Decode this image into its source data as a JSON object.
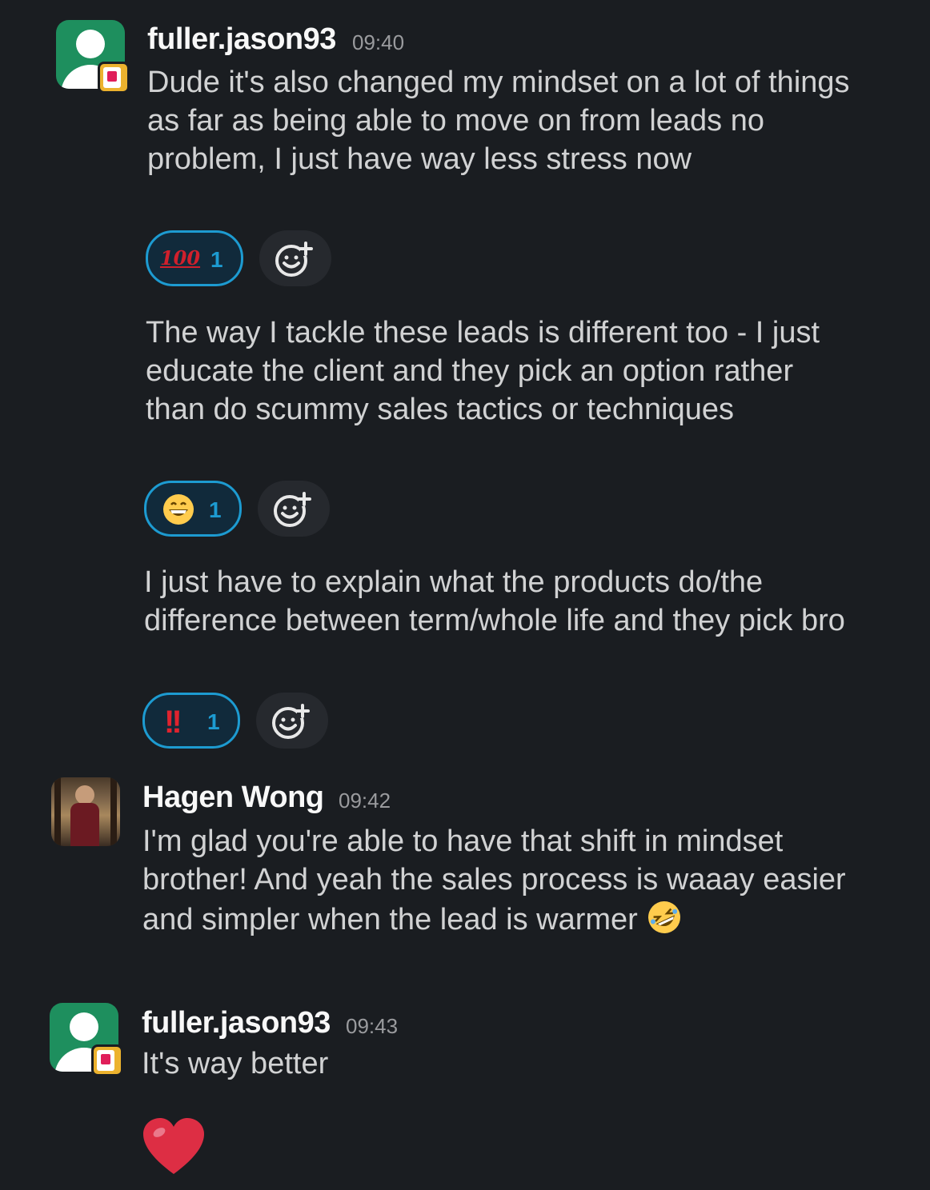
{
  "messages": [
    {
      "username": "fuller.jason93",
      "time": "09:40",
      "paragraphs": [
        {
          "text": "Dude it's also changed my mindset on a lot of things as far as being able to move on from leads no problem, I just have way less stress now",
          "reaction": {
            "emoji": "100",
            "glyph": "100",
            "count": "1"
          }
        },
        {
          "text": "The way I tackle these leads is different too - I just educate the client and they pick an option rather than do scummy sales tactics or techniques",
          "reaction": {
            "emoji": "grin",
            "count": "1"
          }
        },
        {
          "text": "I just have to explain what the products do/the difference between term/whole life and they pick bro",
          "reaction": {
            "emoji": "bangbang",
            "glyph": "!!",
            "count": "1"
          }
        }
      ]
    },
    {
      "username": "Hagen Wong",
      "time": "09:42",
      "text": "I'm glad you're able to have that shift in mindset brother! And yeah the sales process is waaay easier and simpler when the lead is warmer",
      "inline_emoji": "rolling-on-floor-laughing"
    },
    {
      "username": "fuller.jason93",
      "time": "09:43",
      "text": "It's way better",
      "big_emoji": "red-heart"
    }
  ],
  "colors": {
    "background": "#1a1d21",
    "reaction_accent": "#1d9bd1",
    "avatar_green": "#1e8f5e"
  }
}
